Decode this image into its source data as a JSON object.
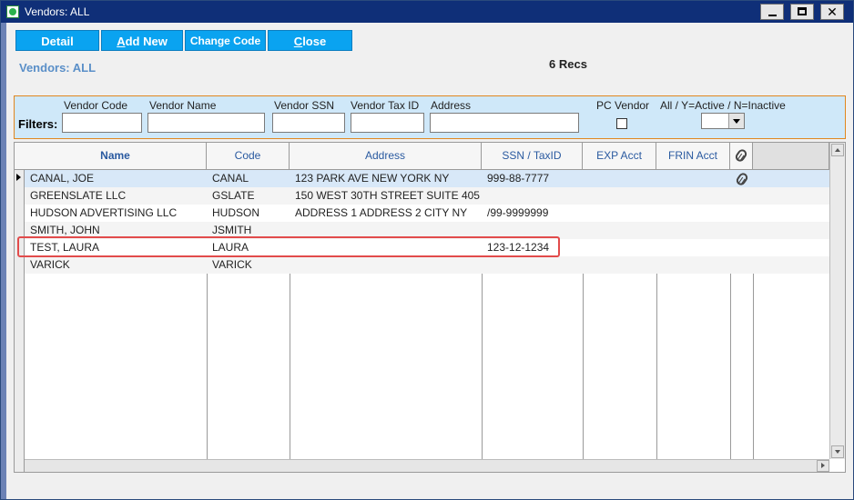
{
  "window": {
    "title": "Vendors: ALL"
  },
  "toolbar": {
    "detail": "Detail",
    "add_new_first": "A",
    "add_new_rest": "dd New",
    "change_code": "Change Code",
    "close_first": "C",
    "close_rest": "lose"
  },
  "header": {
    "label": "Vendors: ALL",
    "record_count": "6 Recs"
  },
  "filters": {
    "title": "Filters:",
    "vendor_code_label": "Vendor Code",
    "vendor_name_label": "Vendor Name",
    "vendor_ssn_label": "Vendor SSN",
    "vendor_taxid_label": "Vendor Tax ID",
    "address_label": "Address",
    "pc_vendor_label": "PC Vendor",
    "active_label": "All / Y=Active / N=Inactive",
    "active_value": ""
  },
  "table": {
    "columns": [
      "Name",
      "Code",
      "Address",
      "SSN / TaxID",
      "EXP Acct",
      "FRIN Acct"
    ],
    "rows": [
      {
        "name": "CANAL, JOE",
        "code": "CANAL",
        "address": "123 PARK AVE   NEW YORK NY",
        "ssn": "999-88-7777",
        "exp": "",
        "frin": "",
        "attachment": true
      },
      {
        "name": "GREENSLATE LLC",
        "code": "GSLATE",
        "address": "150 WEST 30TH STREET SUITE 405",
        "ssn": "",
        "exp": "",
        "frin": "",
        "attachment": false
      },
      {
        "name": "HUDSON ADVERTISING LLC",
        "code": "HUDSON",
        "address": "ADDRESS 1 ADDRESS 2  CITY NY",
        "ssn": "/99-9999999",
        "exp": "",
        "frin": "",
        "attachment": false
      },
      {
        "name": "SMITH, JOHN",
        "code": "JSMITH",
        "address": "",
        "ssn": "",
        "exp": "",
        "frin": "",
        "attachment": false
      },
      {
        "name": "TEST, LAURA",
        "code": "LAURA",
        "address": "",
        "ssn": "123-12-1234",
        "exp": "",
        "frin": "",
        "attachment": false
      },
      {
        "name": "VARICK",
        "code": "VARICK",
        "address": "",
        "ssn": "",
        "exp": "",
        "frin": "",
        "attachment": false
      }
    ]
  },
  "colors": {
    "button": "#0aa3f0",
    "title_bar": "#0f2f78",
    "filter_bg": "#cfe8f9",
    "selected_row": "#d8e8f8",
    "highlight": "#e24b4b"
  }
}
